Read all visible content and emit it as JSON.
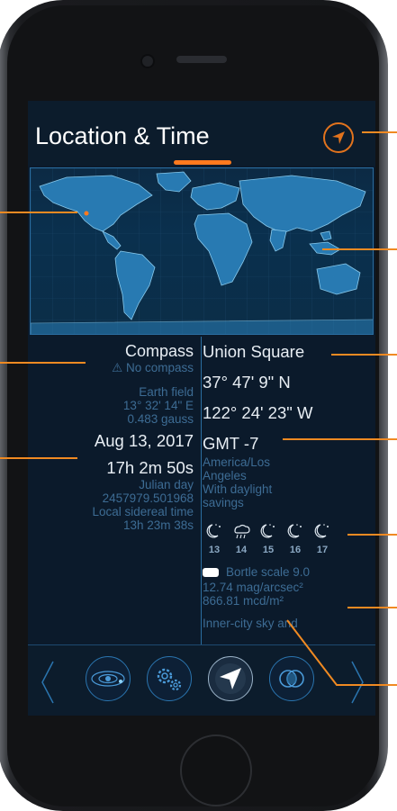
{
  "header": {
    "title": "Location & Time"
  },
  "left": {
    "compass_title": "Compass",
    "compass_status": "⚠ No compass",
    "earth_field_label": "Earth field",
    "earth_field_angle": "13° 32' 14\" E",
    "earth_field_gauss": "0.483 gauss",
    "date": "Aug 13, 2017",
    "time": "17h 2m 50s",
    "julian_label": "Julian day",
    "julian_value": "2457979.501968",
    "sidereal_label": "Local sidereal time",
    "sidereal_value": "13h 23m 38s"
  },
  "right": {
    "place": "Union Square",
    "lat": "37° 47' 9\" N",
    "lon": "122° 24' 23\" W",
    "gmt": "GMT -7",
    "tz_line1": "America/Los",
    "tz_line2": "Angeles",
    "tz_line3": "With daylight",
    "tz_line4": "savings",
    "weather_days": [
      "13",
      "14",
      "15",
      "16",
      "17"
    ],
    "bortle": "Bortle scale 9.0",
    "mag": "12.74 mag/arcsec²",
    "mcd": "866.81  mcd/m²",
    "sky_desc": "Inner-city sky and"
  },
  "colors": {
    "accent": "#ff7a1e",
    "callout": "#f08a22",
    "screen_bg": "#0b1a2b",
    "dim_text": "#3d6c94"
  },
  "icons": [
    "location-arrow-icon",
    "solar-system-icon",
    "gears-icon",
    "location-time-icon",
    "rings-icon",
    "chevron-left-icon",
    "chevron-right-icon",
    "moon-cloud-icon",
    "rain-cloud-icon"
  ]
}
